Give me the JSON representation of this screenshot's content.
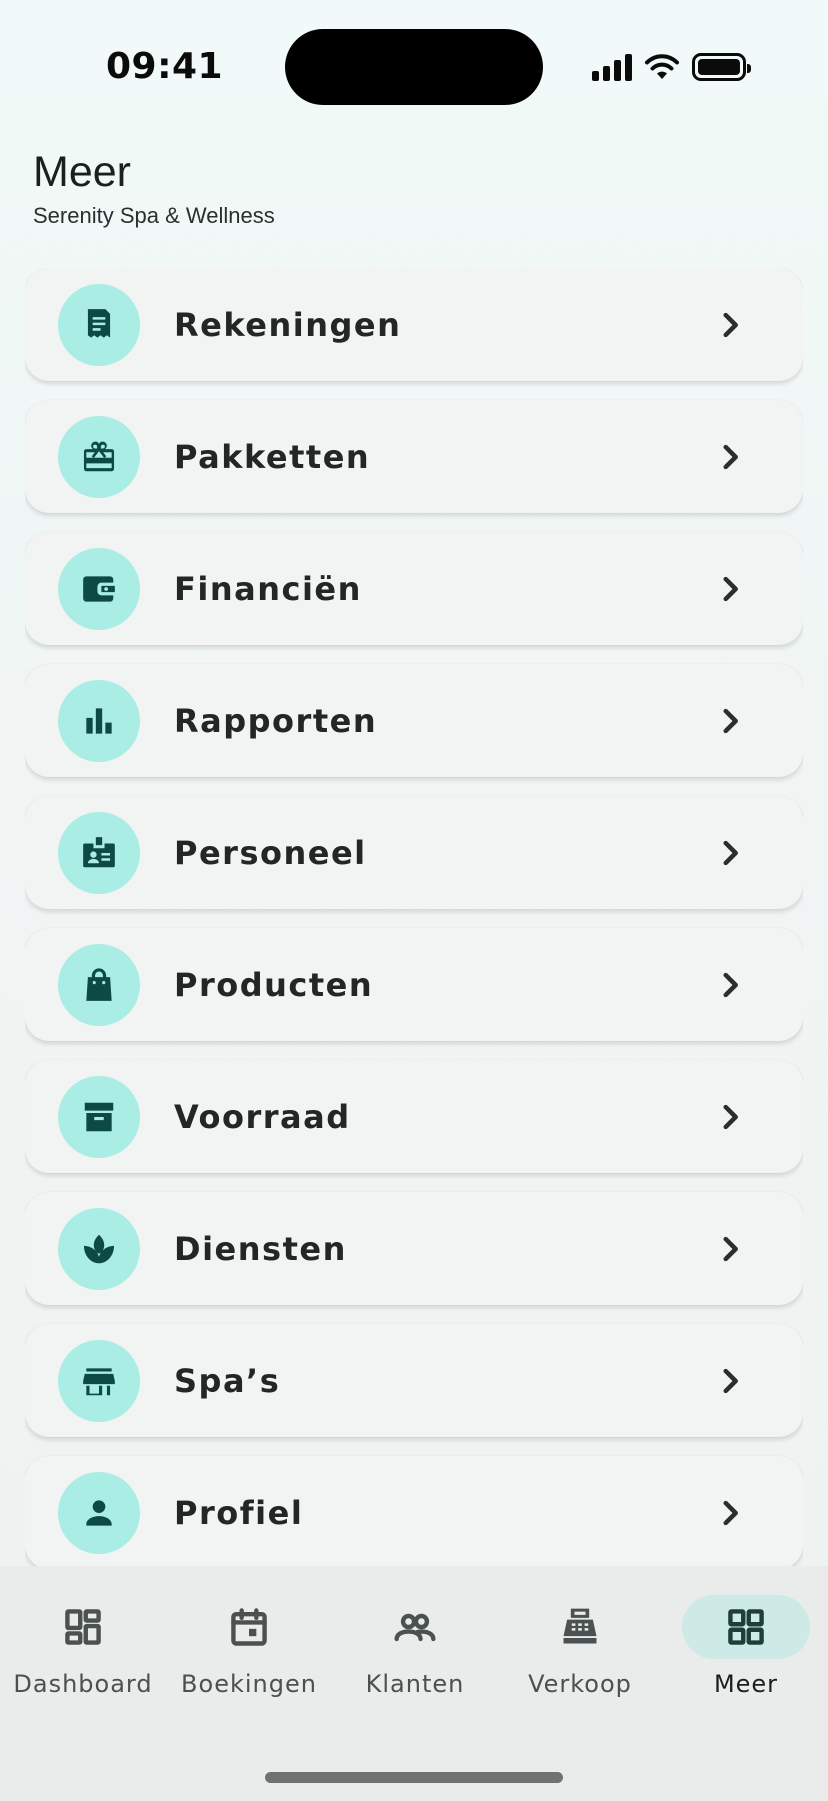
{
  "status_bar": {
    "time": "09:41"
  },
  "header": {
    "title": "Meer",
    "subtitle": "Serenity Spa & Wellness"
  },
  "menu": {
    "items": [
      {
        "label": "Rekeningen",
        "icon": "receipt-icon"
      },
      {
        "label": "Pakketten",
        "icon": "gift-card-icon"
      },
      {
        "label": "Financiën",
        "icon": "wallet-icon"
      },
      {
        "label": "Rapporten",
        "icon": "bar-chart-icon"
      },
      {
        "label": "Personeel",
        "icon": "badge-icon"
      },
      {
        "label": "Producten",
        "icon": "shopping-bag-icon"
      },
      {
        "label": "Voorraad",
        "icon": "archive-box-icon"
      },
      {
        "label": "Diensten",
        "icon": "spa-lotus-icon"
      },
      {
        "label": "Spa’s",
        "icon": "storefront-icon"
      },
      {
        "label": "Profiel",
        "icon": "person-icon"
      }
    ]
  },
  "bottom_nav": {
    "items": [
      {
        "label": "Dashboard",
        "icon": "dashboard-icon"
      },
      {
        "label": "Boekingen",
        "icon": "calendar-icon"
      },
      {
        "label": "Klanten",
        "icon": "people-icon"
      },
      {
        "label": "Verkoop",
        "icon": "cash-register-icon"
      },
      {
        "label": "Meer",
        "icon": "grid-icon",
        "active": true
      }
    ]
  },
  "colors": {
    "accent_circle": "#a9ede4",
    "icon_dark_teal": "#0d4a45",
    "active_nav_pill": "#cdeae6",
    "card_background": "#f2f4f3"
  }
}
